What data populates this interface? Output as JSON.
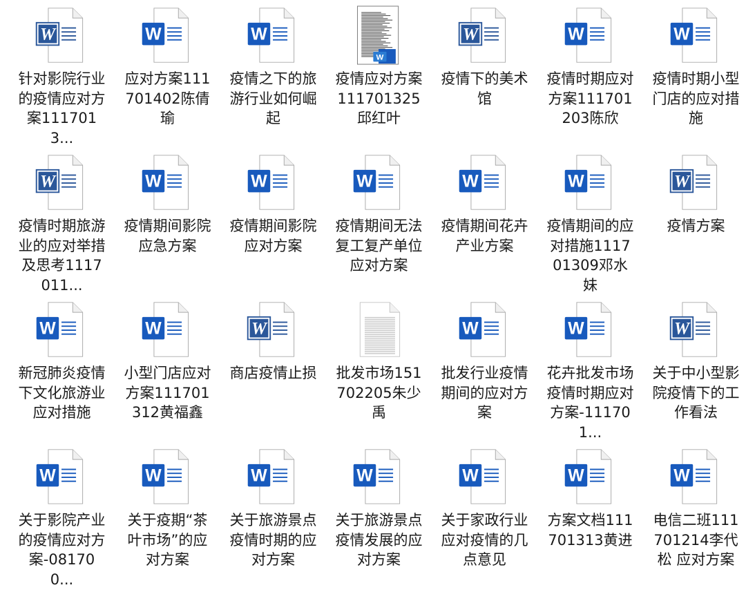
{
  "colors": {
    "word_blue": "#185abd",
    "word_blue_classic": "#2b579a",
    "label_text": "#1a1a1a",
    "background": "#ffffff"
  },
  "files": [
    {
      "name": "针对影院行业的疫情应对方案1117013...",
      "icon": "word-classic-icon"
    },
    {
      "name": "应对方案111701402陈倩瑜",
      "icon": "word-icon"
    },
    {
      "name": "疫情之下的旅游行业如何崛起",
      "icon": "word-icon"
    },
    {
      "name": "疫情应对方案111701325 邱红叶",
      "icon": "word-thumbnail-icon"
    },
    {
      "name": "疫情下的美术馆",
      "icon": "word-classic-icon"
    },
    {
      "name": "疫情时期应对方案111701203陈欣",
      "icon": "word-icon"
    },
    {
      "name": "疫情时期小型门店的应对措施",
      "icon": "word-icon"
    },
    {
      "name": "疫情时期旅游业的应对举措及思考1117011...",
      "icon": "word-classic-icon"
    },
    {
      "name": "疫情期间影院应急方案",
      "icon": "word-icon"
    },
    {
      "name": "疫情期间影院应对方案",
      "icon": "word-icon"
    },
    {
      "name": "疫情期间无法复工复产单位应对方案",
      "icon": "word-icon"
    },
    {
      "name": "疫情期间花卉产业方案",
      "icon": "word-icon"
    },
    {
      "name": "疫情期间的应对措施111701309邓水妹",
      "icon": "word-icon"
    },
    {
      "name": "疫情方案",
      "icon": "word-classic-icon"
    },
    {
      "name": "新冠肺炎疫情下文化旅游业应对措施",
      "icon": "word-icon"
    },
    {
      "name": "小型门店应对方案111701312黄福鑫",
      "icon": "word-icon"
    },
    {
      "name": "商店疫情止损",
      "icon": "word-classic-icon"
    },
    {
      "name": "批发市场151702205朱少禹",
      "icon": "text-document-icon"
    },
    {
      "name": "批发行业疫情期间的应对方案",
      "icon": "word-icon"
    },
    {
      "name": "花卉批发市场疫情时期应对方案-111701...",
      "icon": "word-icon"
    },
    {
      "name": "关于中小型影院疫情下的工作看法",
      "icon": "word-classic-icon"
    },
    {
      "name": "关于影院产业的疫情应对方案-081700...",
      "icon": "word-icon"
    },
    {
      "name": "关于疫期“茶叶市场”的应对方案",
      "icon": "word-icon"
    },
    {
      "name": "关于旅游景点疫情时期的应对方案",
      "icon": "word-icon"
    },
    {
      "name": "关于旅游景点疫情发展的应对方案",
      "icon": "word-icon"
    },
    {
      "name": "关于家政行业应对疫情的几点意见",
      "icon": "word-icon"
    },
    {
      "name": "方案文档111701313黄进",
      "icon": "word-icon"
    },
    {
      "name": "电信二班111701214李代松 应对方案",
      "icon": "word-icon"
    }
  ]
}
